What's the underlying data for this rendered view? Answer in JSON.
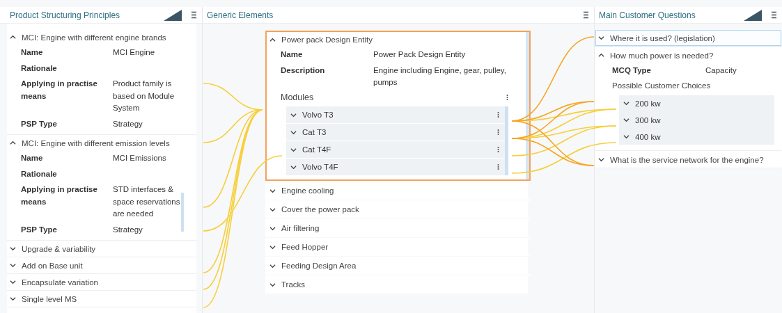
{
  "psp_panel": {
    "title": "Product Structuring Principles",
    "items": [
      {
        "title": "MCI: Engine with different engine brands",
        "expanded": true,
        "fields": [
          {
            "label": "Name",
            "value": "MCI Engine"
          },
          {
            "label": "Rationale"
          },
          {
            "label": "Applying in practise means",
            "value": "Product family is based on Module System"
          },
          {
            "label": "PSP Type",
            "value": "Strategy"
          }
        ]
      },
      {
        "title": "MCI: Engine with different emission levels",
        "expanded": true,
        "fields": [
          {
            "label": "Name",
            "value": "MCI Emissions"
          },
          {
            "label": "Rationale"
          },
          {
            "label": "Applying in practise means",
            "value": "STD interfaces & space reservations are needed"
          },
          {
            "label": "PSP Type",
            "value": "Strategy"
          }
        ]
      },
      {
        "title": "Upgrade & variability",
        "expanded": false
      },
      {
        "title": "Add on Base unit",
        "expanded": false
      },
      {
        "title": "Encapsulate variation",
        "expanded": false
      },
      {
        "title": "Single level MS",
        "expanded": false
      }
    ]
  },
  "generic_panel": {
    "title": "Generic Elements",
    "items": [
      {
        "title": "Power pack Design Entity",
        "expanded": true,
        "selected": true,
        "fields": [
          {
            "label": "Name",
            "value": "Power Pack Design Entity"
          },
          {
            "label": "Description",
            "value": "Engine including Engine, gear, pulley, pumps"
          }
        ],
        "modules_title": "Modules",
        "modules": [
          {
            "title": "Volvo T3",
            "expanded": false
          },
          {
            "title": "Cat T3",
            "expanded": false
          },
          {
            "title": "Cat T4F",
            "expanded": false
          },
          {
            "title": "Volvo T4F",
            "expanded": false
          }
        ]
      },
      {
        "title": "Engine cooling",
        "expanded": false,
        "selected": false
      },
      {
        "title": "Cover the power pack",
        "expanded": false,
        "selected": false
      },
      {
        "title": "Air filtering",
        "expanded": false,
        "selected": false
      },
      {
        "title": "Feed Hopper",
        "expanded": false,
        "selected": false
      },
      {
        "title": "Feeding Design Area",
        "expanded": false,
        "selected": false
      },
      {
        "title": "Tracks",
        "expanded": false,
        "selected": false
      }
    ]
  },
  "mcq_panel": {
    "title": "Main Customer Questions",
    "items": [
      {
        "title": "Where it is used? (legislation)",
        "expanded": false,
        "selected": true
      },
      {
        "title": "How much power is needed?",
        "expanded": true,
        "selected": false,
        "fields": [
          {
            "label": "MCQ Type",
            "value": "Capacity"
          }
        ],
        "choices_title": "Possible Customer Choices",
        "choices": [
          {
            "title": "200 kw",
            "expanded": false
          },
          {
            "title": "300 kw",
            "expanded": false
          },
          {
            "title": "400 kw",
            "expanded": false
          }
        ]
      },
      {
        "title": "What is the service network for the engine?",
        "expanded": false,
        "selected": false
      }
    ]
  }
}
